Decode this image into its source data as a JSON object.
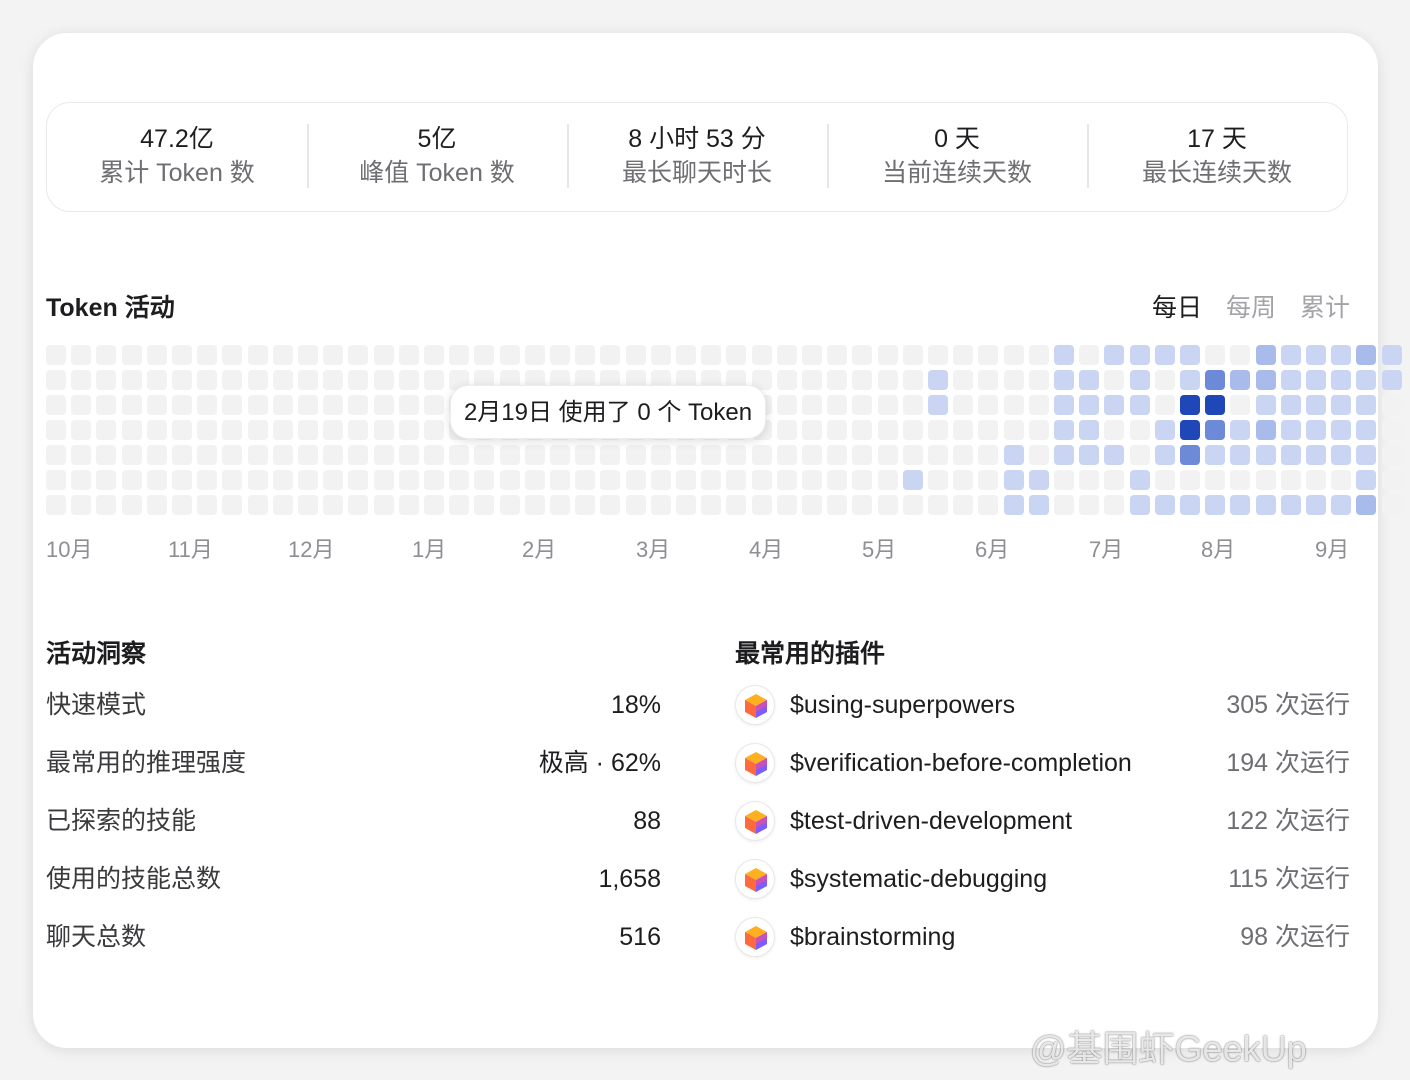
{
  "stats": [
    {
      "value": "47.2亿",
      "label": "累计 Token 数"
    },
    {
      "value": "5亿",
      "label": "峰值 Token 数"
    },
    {
      "value": "8 小时 53 分",
      "label": "最长聊天时长"
    },
    {
      "value": "0 天",
      "label": "当前连续天数"
    },
    {
      "value": "17 天",
      "label": "最长连续天数"
    }
  ],
  "activity": {
    "title": "Token 活动",
    "tabs": [
      "每日",
      "每周",
      "累计"
    ],
    "active_tab": "每日",
    "tooltip": "2月19日 使用了 0 个 Token",
    "months": [
      "10月",
      "11月",
      "12月",
      "1月",
      "2月",
      "3月",
      "4月",
      "5月",
      "6月",
      "7月",
      "8月",
      "9月"
    ],
    "colors": {
      "0": "#f2f2f3",
      "1": "#c9d5f2",
      "2": "#a8bbea",
      "3": "#6c8ad8",
      "4": "#1f47b8"
    },
    "levels_by_week": [
      "0000000",
      "0000000",
      "0000000",
      "0000000",
      "0000000",
      "0000000",
      "0000000",
      "0000000",
      "0000000",
      "0000000",
      "0000000",
      "0000000",
      "0000000",
      "0000000",
      "0000000",
      "0000000",
      "0000000",
      "0000000",
      "0000000",
      "0000000",
      "0000000",
      "0000000",
      "0000000",
      "0000000",
      "0000000",
      "0000000",
      "0000000",
      "0000000",
      "0000000",
      "0000000",
      "0000000",
      "0000000",
      "0000000",
      "0000000",
      "0000010",
      "0110000",
      "0000000",
      "0000000",
      "0000111",
      "0000011",
      "1111100",
      "0111100",
      "1010100",
      "1110011",
      "1001101",
      "1144301",
      "0343101",
      "0201101",
      "2212101",
      "1111101",
      "1111101",
      "1111101",
      "2111112",
      "1100000"
    ]
  },
  "insights": {
    "title": "活动洞察",
    "rows": [
      {
        "label": "快速模式",
        "value": "18%"
      },
      {
        "label": "最常用的推理强度",
        "value": "极高 · 62%"
      },
      {
        "label": "已探索的技能",
        "value": "88"
      },
      {
        "label": "使用的技能总数",
        "value": "1,658"
      },
      {
        "label": "聊天总数",
        "value": "516"
      }
    ]
  },
  "plugins": {
    "title": "最常用的插件",
    "icon": "superpowers-cube-icon",
    "rows": [
      {
        "name": "$using-superpowers",
        "count": "305 次运行"
      },
      {
        "name": "$verification-before-completion",
        "count": "194 次运行"
      },
      {
        "name": "$test-driven-development",
        "count": "122 次运行"
      },
      {
        "name": "$systematic-debugging",
        "count": "115 次运行"
      },
      {
        "name": "$brainstorming",
        "count": "98 次运行"
      }
    ]
  },
  "watermark": "@基围虾GeekUp"
}
